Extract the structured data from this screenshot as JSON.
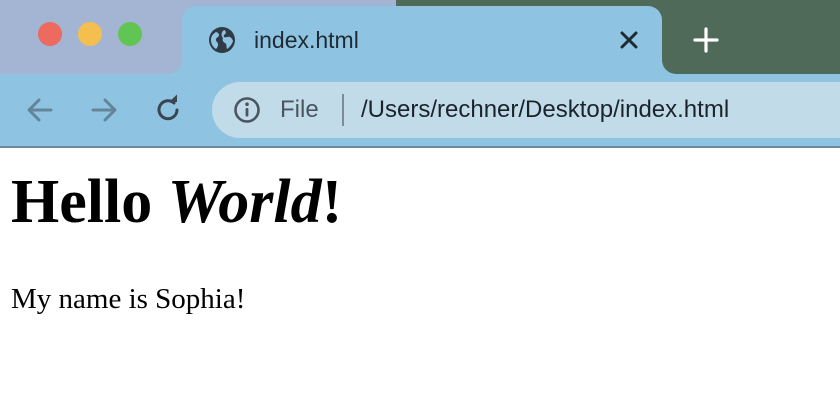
{
  "window": {
    "traffic_lights": [
      "close",
      "minimize",
      "maximize"
    ]
  },
  "tab": {
    "title": "index.html",
    "favicon": "globe-icon"
  },
  "toolbar": {
    "back": "back-arrow-icon",
    "forward": "forward-arrow-icon",
    "reload": "reload-icon"
  },
  "omnibox": {
    "scheme_label": "File",
    "url": "/Users/rechner/Desktop/index.html"
  },
  "page": {
    "heading_part1": "Hello ",
    "heading_italic": "World",
    "heading_part2": "!",
    "paragraph": "My name is Sophia!"
  },
  "colors": {
    "tabstrip_bg": "#a3b5d2",
    "tabstrip_right_bg": "#4f6a59",
    "active_tab_bg": "#8ec4e2",
    "toolbar_bg": "#8ec4e2",
    "omnibox_bg": "#c2dbe8",
    "traffic_close": "#ec6a5e",
    "traffic_minimize": "#f4bf4f",
    "traffic_maximize": "#61c554"
  }
}
